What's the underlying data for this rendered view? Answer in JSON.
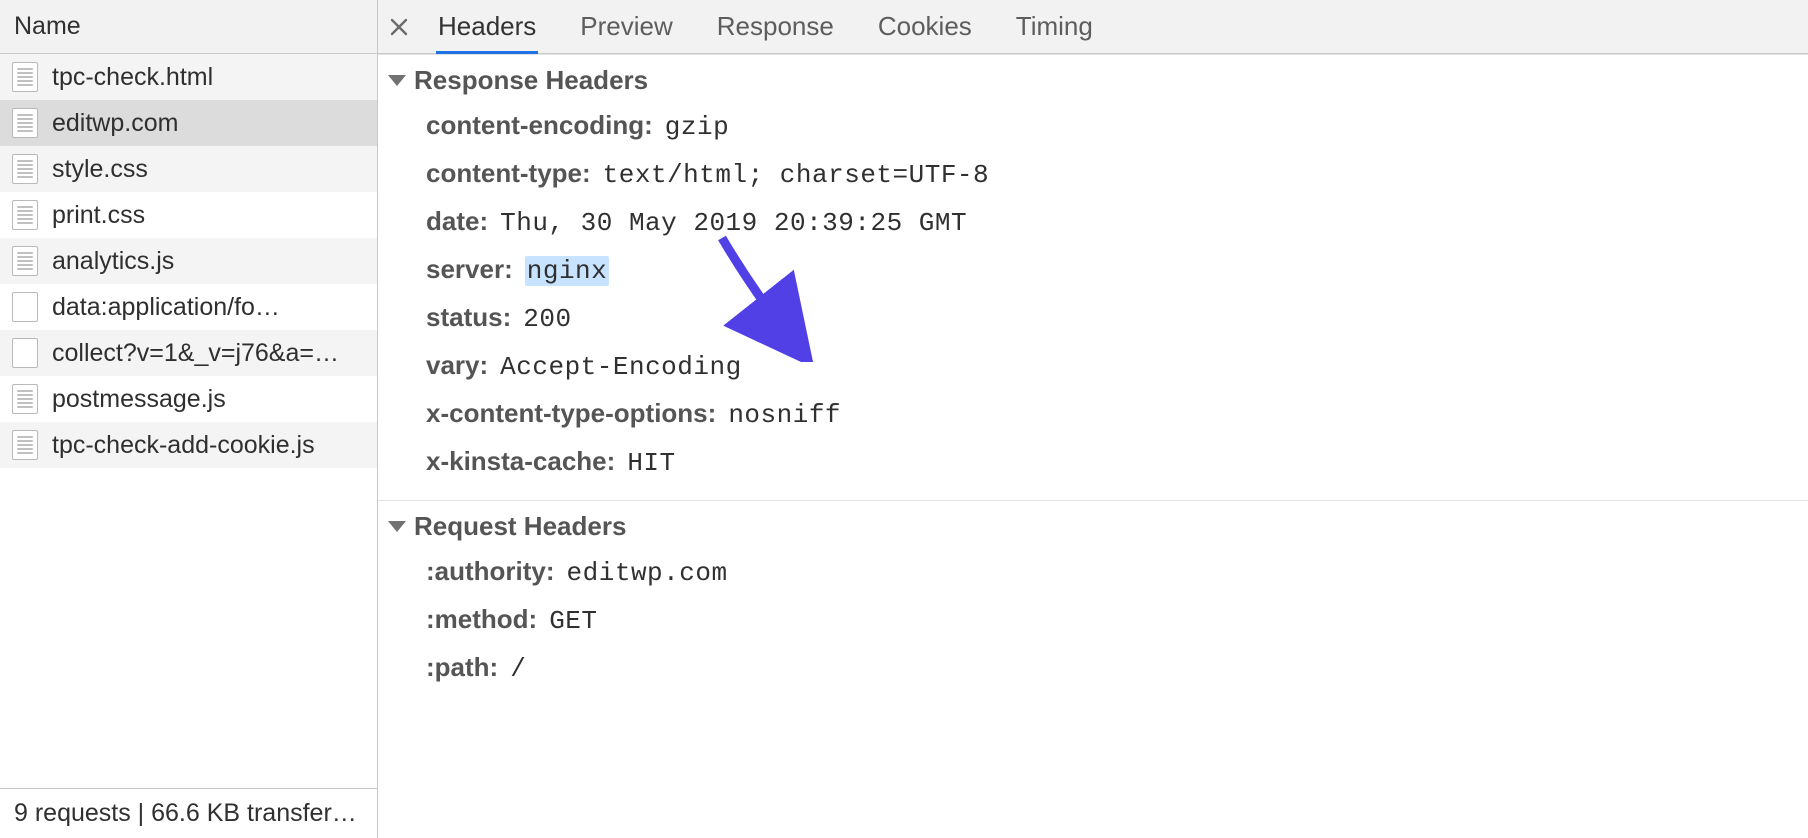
{
  "left": {
    "header": "Name",
    "requests": [
      {
        "name": "tpc-check.html",
        "icon": "doc"
      },
      {
        "name": "editwp.com",
        "icon": "doc",
        "selected": true
      },
      {
        "name": "style.css",
        "icon": "doc"
      },
      {
        "name": "print.css",
        "icon": "doc"
      },
      {
        "name": "analytics.js",
        "icon": "doc"
      },
      {
        "name": "data:application/fo…",
        "icon": "blank"
      },
      {
        "name": "collect?v=1&_v=j76&a=…",
        "icon": "blank"
      },
      {
        "name": "postmessage.js",
        "icon": "doc"
      },
      {
        "name": "tpc-check-add-cookie.js",
        "icon": "doc"
      }
    ],
    "status": "9 requests | 66.6 KB transfer…"
  },
  "tabs": {
    "items": [
      {
        "label": "Headers",
        "active": true
      },
      {
        "label": "Preview"
      },
      {
        "label": "Response"
      },
      {
        "label": "Cookies"
      },
      {
        "label": "Timing"
      }
    ]
  },
  "sections": {
    "response_headers_title": "Response Headers",
    "request_headers_title": "Request Headers",
    "response": [
      {
        "k": "content-encoding:",
        "v": "gzip"
      },
      {
        "k": "content-type:",
        "v": "text/html; charset=UTF-8"
      },
      {
        "k": "date:",
        "v": "Thu, 30 May 2019 20:39:25 GMT"
      },
      {
        "k": "server:",
        "v": "nginx",
        "hl": true
      },
      {
        "k": "status:",
        "v": "200"
      },
      {
        "k": "vary:",
        "v": "Accept-Encoding"
      },
      {
        "k": "x-content-type-options:",
        "v": "nosniff"
      },
      {
        "k": "x-kinsta-cache:",
        "v": "HIT"
      }
    ],
    "request": [
      {
        "k": ":authority:",
        "v": "editwp.com"
      },
      {
        "k": ":method:",
        "v": "GET"
      },
      {
        "k": ":path:",
        "v": "/"
      }
    ]
  }
}
